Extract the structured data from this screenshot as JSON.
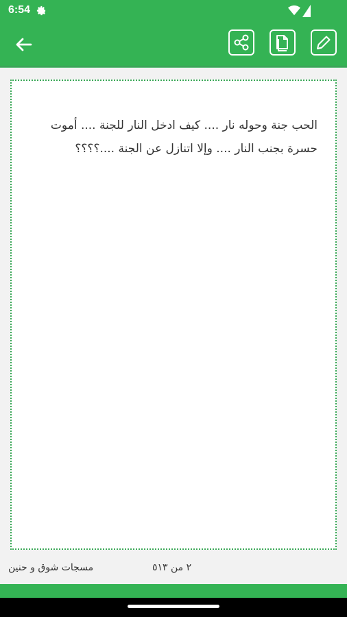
{
  "status_bar": {
    "time": "6:54",
    "icons": [
      "gear-icon",
      "wifi-icon",
      "battery-icon"
    ]
  },
  "toolbar": {
    "color": "#34b354",
    "buttons": [
      "back-arrow-icon",
      "share-icon",
      "copy-icon",
      "edit-icon"
    ]
  },
  "message": {
    "text": "الحب جنة وحوله نار .... كيف ادخل النار للجنة .... أموت حسرة بجنب النار .... وإلا اتنازل عن الجنة ....؟؟؟؟"
  },
  "footer": {
    "category": "مسجات شوق و حنين",
    "counter": "٢ من ٥١٣"
  }
}
